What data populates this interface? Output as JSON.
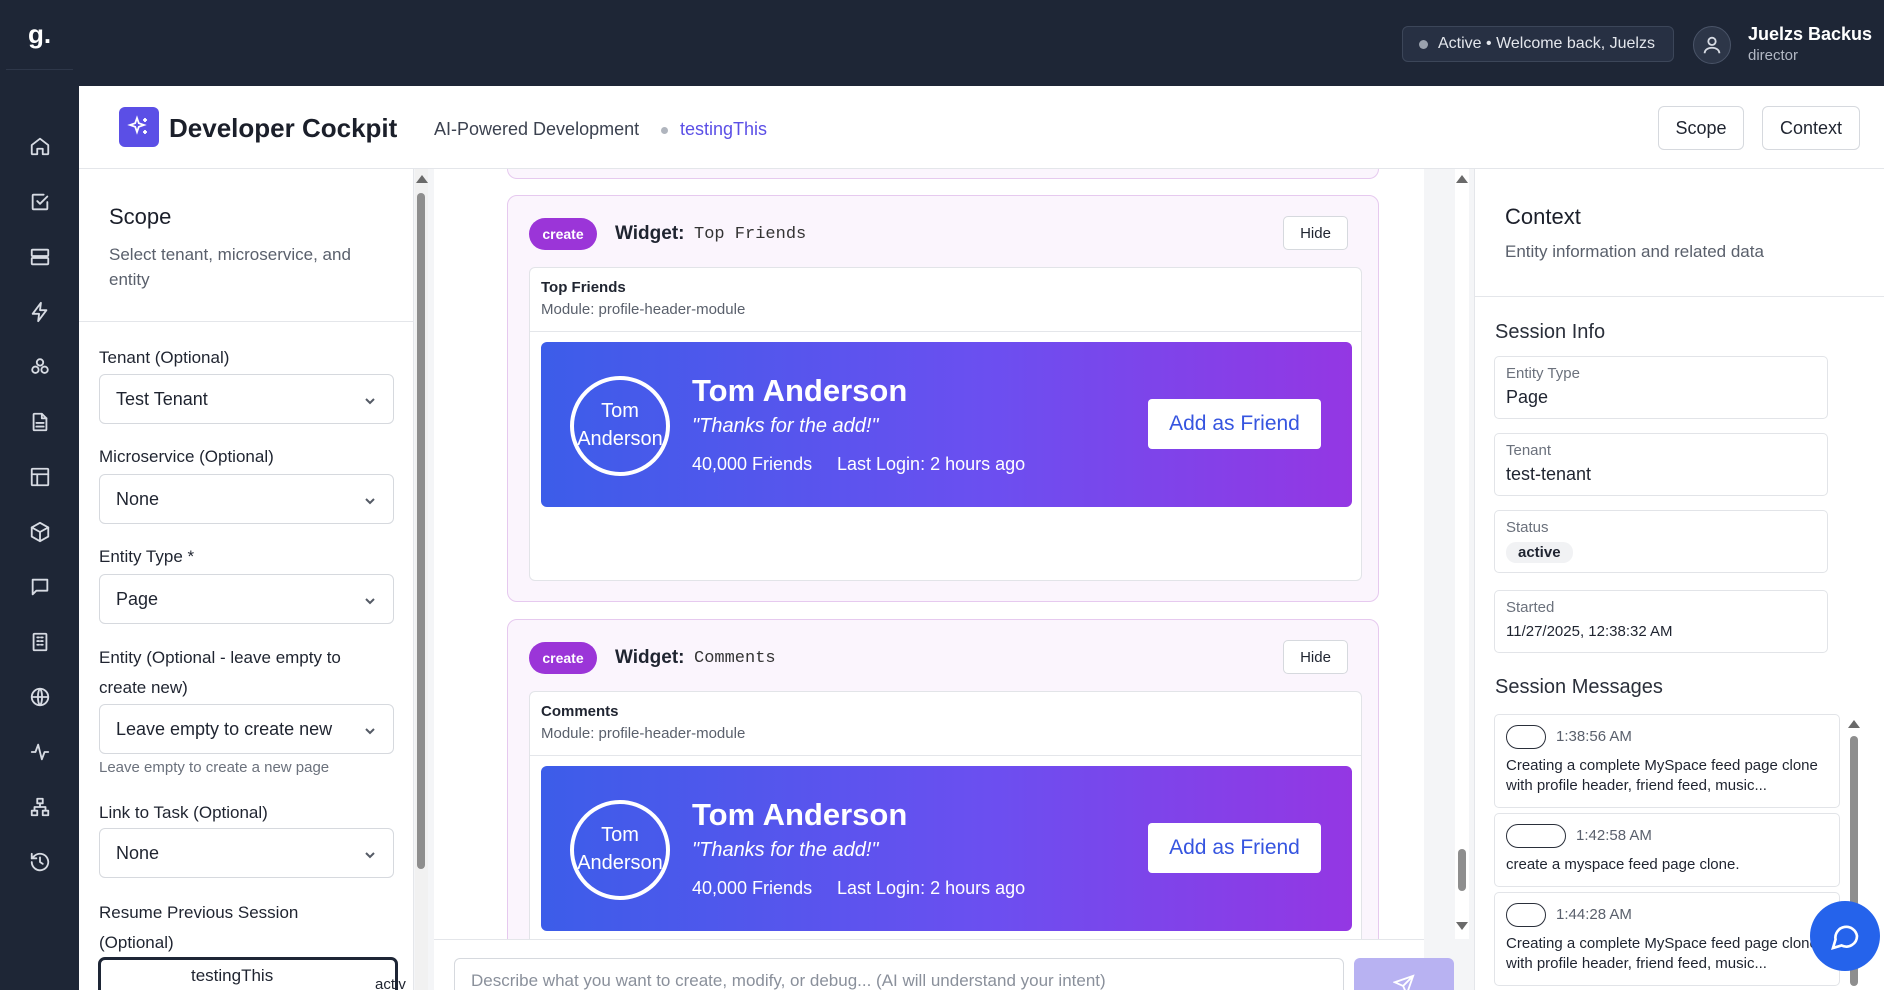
{
  "brand": {
    "logo": "g."
  },
  "topbar": {
    "status_text": "Active • Welcome back, Juelzs",
    "user_name": "Juelzs Backus",
    "user_role": "director"
  },
  "nav_icons": [
    "home-icon",
    "check-square-icon",
    "database-icon",
    "bolt-icon",
    "cluster-icon",
    "document-icon",
    "layout-icon",
    "cube-icon",
    "chat-icon",
    "building-icon",
    "globe-icon",
    "activity-icon",
    "network-icon",
    "history-icon"
  ],
  "header": {
    "title": "Developer Cockpit",
    "subtitle": "AI-Powered Development",
    "project": "testingThis",
    "scope_button": "Scope",
    "context_button": "Context"
  },
  "scope": {
    "title": "Scope",
    "description": "Select tenant, microservice, and entity",
    "tenant_label": "Tenant (Optional)",
    "tenant_value": "Test Tenant",
    "microservice_label": "Microservice (Optional)",
    "microservice_value": "None",
    "entity_type_label": "Entity Type *",
    "entity_type_value": "Page",
    "entity_label": "Entity (Optional - leave empty to create new)",
    "entity_value": "Leave empty to create new",
    "entity_hint": "Leave empty to create a new page",
    "task_label": "Link to Task (Optional)",
    "task_value": "None",
    "resume_label": "Resume Previous Session (Optional)",
    "resume_name": "testingThis",
    "resume_status": "activ"
  },
  "widgets": [
    {
      "badge": "create",
      "label": "Widget:",
      "name": "Top Friends",
      "hide_label": "Hide",
      "inner_title": "Top Friends",
      "module": "Module: profile-header-module",
      "profile": {
        "pic_alt": "Tom Anderson",
        "name": "Tom Anderson",
        "quote": "\"Thanks for the add!\"",
        "friends": "40,000 Friends",
        "last_login": "Last Login: 2 hours ago",
        "button": "Add as Friend"
      }
    },
    {
      "badge": "create",
      "label": "Widget:",
      "name": "Comments",
      "hide_label": "Hide",
      "inner_title": "Comments",
      "module": "Module: profile-header-module",
      "profile": {
        "pic_alt": "Tom Anderson",
        "name": "Tom Anderson",
        "quote": "\"Thanks for the add!\"",
        "friends": "40,000 Friends",
        "last_login": "Last Login: 2 hours ago",
        "button": "Add as Friend"
      }
    }
  ],
  "composer": {
    "placeholder": "Describe what you want to create, modify, or debug... (AI will understand your intent)"
  },
  "context": {
    "title": "Context",
    "description": "Entity information and related data",
    "session_info_title": "Session Info",
    "entity_type_key": "Entity Type",
    "entity_type_val": "Page",
    "tenant_key": "Tenant",
    "tenant_val": "test-tenant",
    "status_key": "Status",
    "status_val": "active",
    "started_key": "Started",
    "started_val": "11/27/2025, 12:38:32 AM",
    "messages_title": "Session Messages",
    "messages": [
      {
        "time": "1:38:56 AM",
        "text": "Creating a complete MySpace feed page clone with profile header, friend feed, music..."
      },
      {
        "time": "1:42:58 AM",
        "text": "create a myspace feed page clone."
      },
      {
        "time": "1:44:28 AM",
        "text": "Creating a complete MySpace feed page clone with profile header, friend feed, music..."
      }
    ]
  },
  "colors": {
    "nav_bg": "#1e2636",
    "accent": "#5b4fe6",
    "badge": "#9b35d8",
    "gradient_start": "#3c5de9",
    "gradient_end": "#9437e3",
    "fab": "#2563eb"
  }
}
